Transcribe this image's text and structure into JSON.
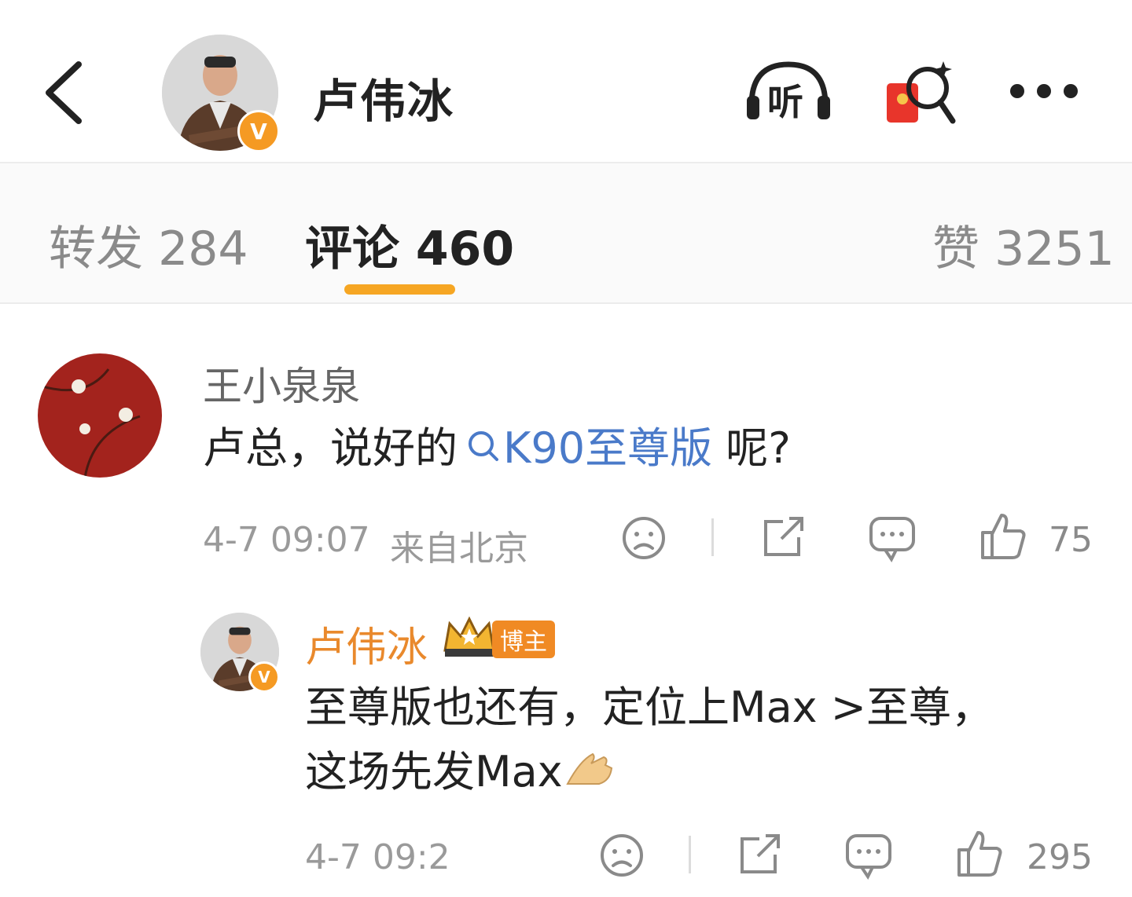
{
  "header": {
    "title": "卢伟冰",
    "listen_label": "听"
  },
  "tabs": [
    {
      "label": "转发 284"
    },
    {
      "label": "评论 460"
    },
    {
      "label": "赞 3251"
    }
  ],
  "comments": [
    {
      "author": "王小泉泉",
      "text_prefix": "卢总，说好的",
      "topic": "K90至尊版",
      "text_suffix": " 呢?",
      "time": "4-7 09:07",
      "location": "来自北京",
      "likes": "75"
    }
  ],
  "reply": {
    "author": "卢伟冰",
    "badge": "博主",
    "line1": "至尊版也还有，定位上Max >至尊，",
    "line2": "这场先发Max",
    "time": "4-7 09:2",
    "likes": "295"
  },
  "colors": {
    "accent": "#f6a623",
    "topic": "#4a7ac9",
    "reply_name": "#e9892c",
    "verify": "#f59a23"
  }
}
